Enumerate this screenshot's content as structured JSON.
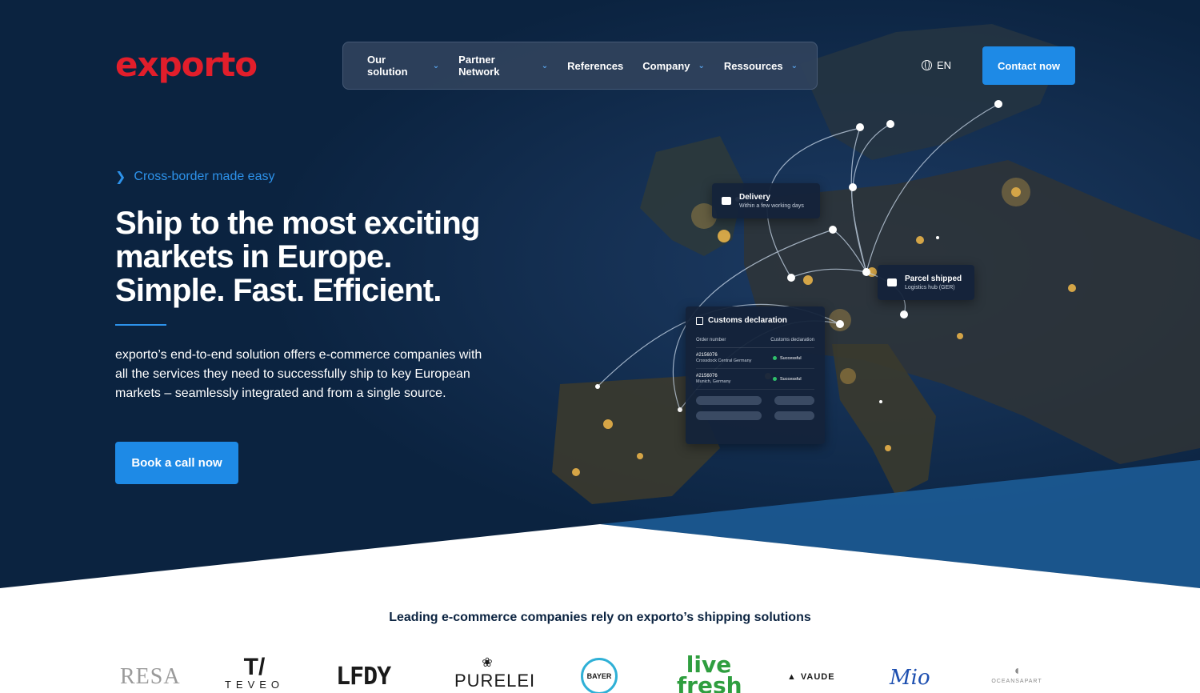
{
  "brand": {
    "logo_text": "exporto",
    "accent": "#e21e2b",
    "primary": "#1e8ae6",
    "background": "#0b2340"
  },
  "nav": {
    "items": [
      {
        "label": "Our solution",
        "has_dropdown": true
      },
      {
        "label": "Partner Network",
        "has_dropdown": true
      },
      {
        "label": "References",
        "has_dropdown": false
      },
      {
        "label": "Company",
        "has_dropdown": true
      },
      {
        "label": "Ressources",
        "has_dropdown": true
      }
    ],
    "language": "EN",
    "cta": "Contact now"
  },
  "hero": {
    "eyebrow": "Cross-border made easy",
    "headline_lines": [
      "Ship to the most exciting",
      "markets in Europe.",
      "Simple. Fast. Efficient."
    ],
    "intro": "exporto’s end-to-end solution offers e-commerce companies with all the services they need to successfully ship to key European markets – seamlessly integrated and from a single source.",
    "cta": "Book a call now"
  },
  "map_cards": {
    "delivery": {
      "title": "Delivery",
      "subtitle": "Within a few working days"
    },
    "parcel": {
      "title": "Parcel shipped",
      "subtitle": "Logistics hub (GER)"
    },
    "customs": {
      "title": "Customs declaration",
      "col_order": "Order number",
      "col_customs": "Customs declaration",
      "rows": [
        {
          "order": "#2156076",
          "location": "Crossdock Central Germany",
          "status": "Successful"
        },
        {
          "order": "#2156076",
          "location": "Munich, Germany",
          "status": "Successful"
        }
      ]
    }
  },
  "clients": {
    "title": "Leading e-commerce companies rely on exporto’s shipping solutions",
    "logos": [
      {
        "name": "RESA",
        "icon": "resa-logo"
      },
      {
        "name": "TEVEO",
        "icon": "teveo-logo"
      },
      {
        "name": "LFDY",
        "icon": "lfdy-logo"
      },
      {
        "name": "PURELEI",
        "icon": "purelei-logo"
      },
      {
        "name": "BAYER",
        "icon": "bayer-logo"
      },
      {
        "name": "live fresh",
        "icon": "livefresh-logo"
      },
      {
        "name": "VAUDE",
        "icon": "vaude-logo"
      },
      {
        "name": "Mio",
        "icon": "mio-logo"
      },
      {
        "name": "OCEANSAPART",
        "icon": "oceansapart-logo"
      }
    ]
  }
}
